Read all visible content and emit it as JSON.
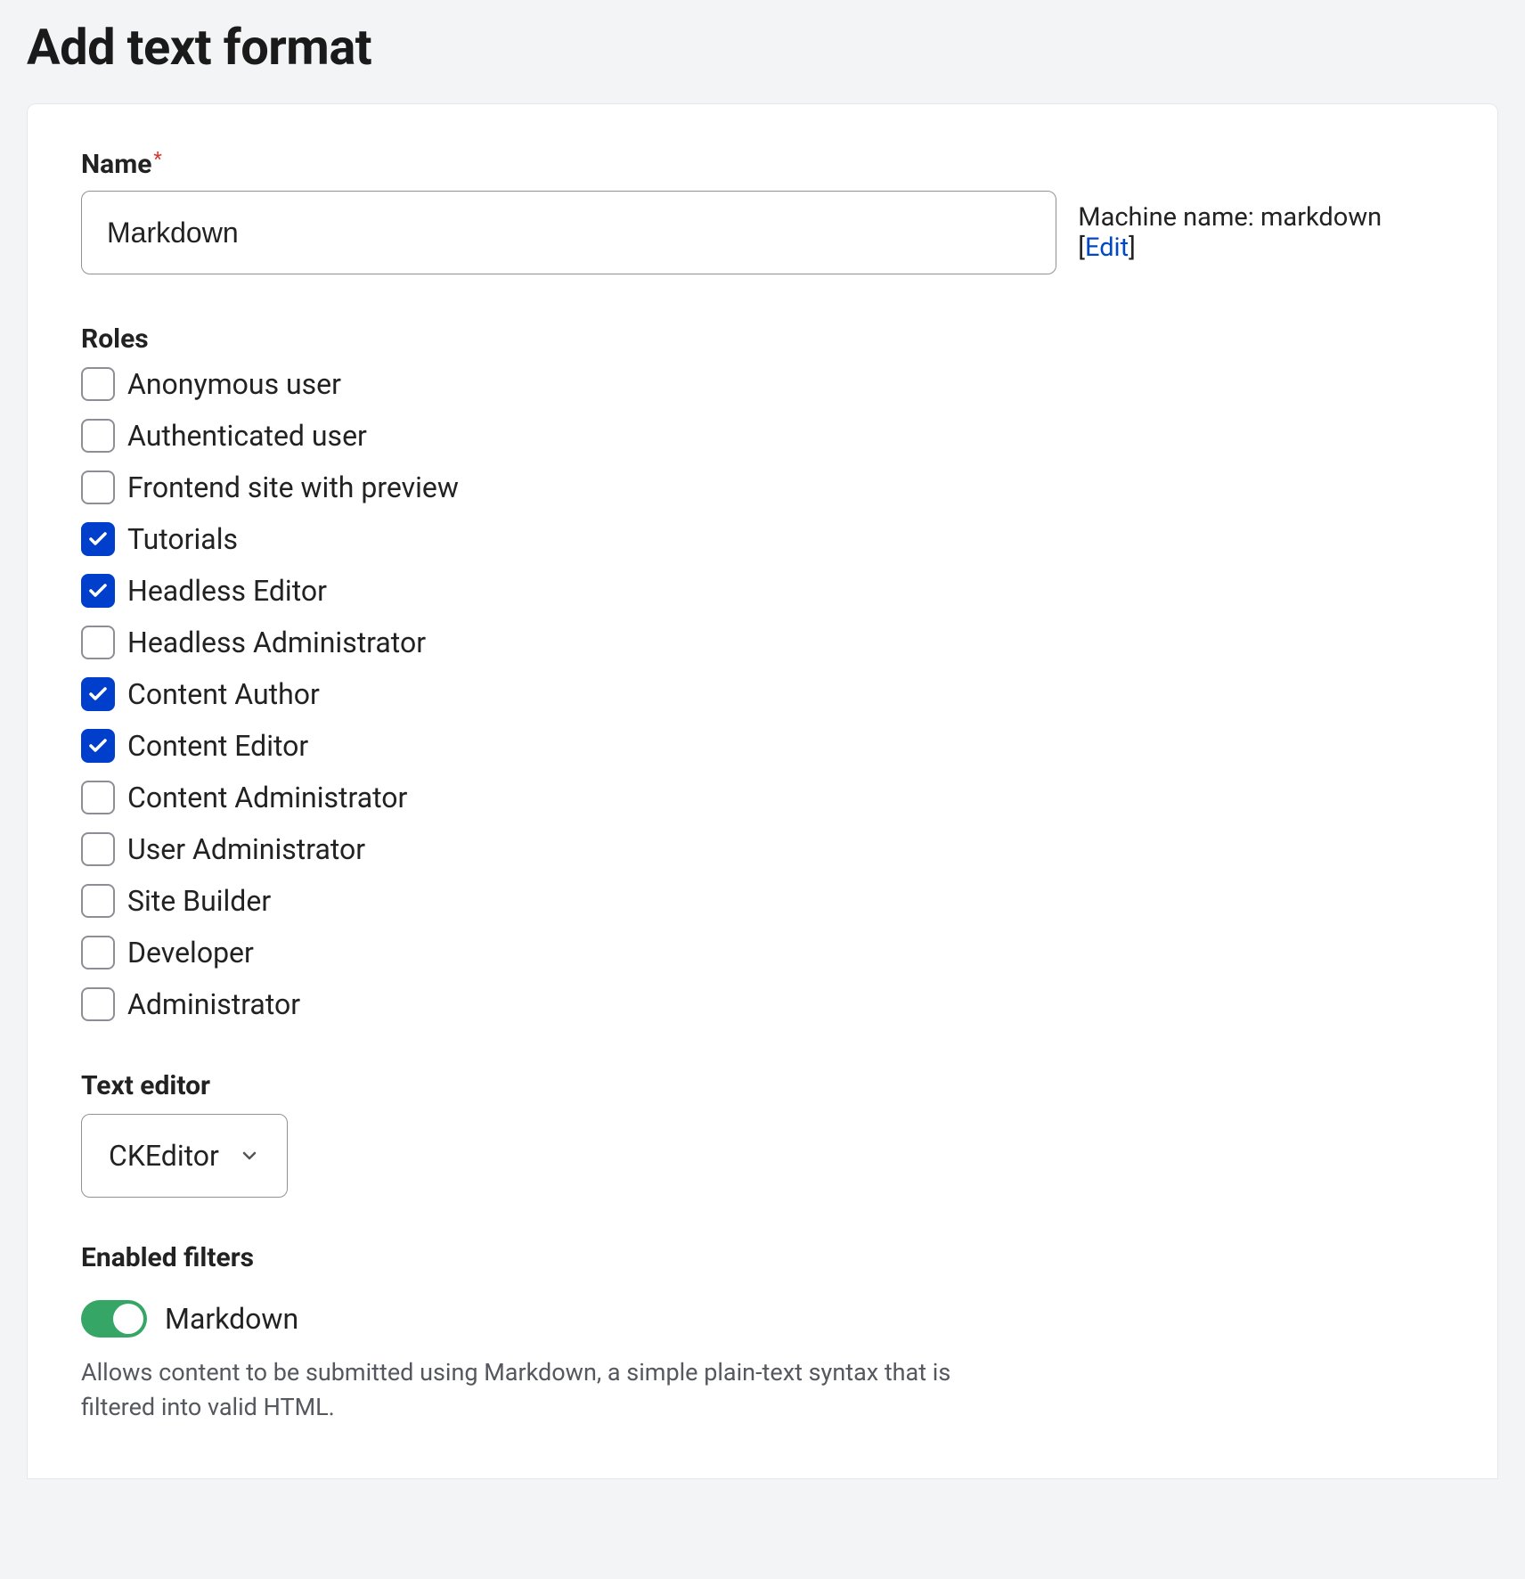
{
  "page": {
    "title": "Add text format"
  },
  "name_field": {
    "label": "Name",
    "value": "Markdown"
  },
  "machine_name": {
    "prefix": "Machine name: ",
    "value": "markdown",
    "edit_label": "Edit"
  },
  "roles": {
    "label": "Roles",
    "items": [
      {
        "label": "Anonymous user",
        "checked": false
      },
      {
        "label": "Authenticated user",
        "checked": false
      },
      {
        "label": "Frontend site with preview",
        "checked": false
      },
      {
        "label": "Tutorials",
        "checked": true
      },
      {
        "label": "Headless Editor",
        "checked": true
      },
      {
        "label": "Headless Administrator",
        "checked": false
      },
      {
        "label": "Content Author",
        "checked": true
      },
      {
        "label": "Content Editor",
        "checked": true
      },
      {
        "label": "Content Administrator",
        "checked": false
      },
      {
        "label": "User Administrator",
        "checked": false
      },
      {
        "label": "Site Builder",
        "checked": false
      },
      {
        "label": "Developer",
        "checked": false
      },
      {
        "label": "Administrator",
        "checked": false
      }
    ]
  },
  "text_editor": {
    "label": "Text editor",
    "value": "CKEditor"
  },
  "enabled_filters": {
    "label": "Enabled filters",
    "items": [
      {
        "label": "Markdown",
        "enabled": true,
        "description": "Allows content to be submitted using Markdown, a simple plain-text syntax that is filtered into valid HTML."
      }
    ]
  }
}
